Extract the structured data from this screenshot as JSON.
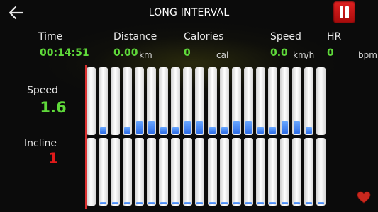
{
  "header": {
    "title": "LONG INTERVAL",
    "back_icon": "arrow-left-icon",
    "pause_icon": "pause-icon",
    "pause_color": "#d01818"
  },
  "stats": {
    "time": {
      "label": "Time",
      "value": "00:14:51",
      "unit": ""
    },
    "distance": {
      "label": "Distance",
      "value": "0.00",
      "unit": "km"
    },
    "calories": {
      "label": "Calories",
      "value": "0",
      "unit": "cal"
    },
    "speed": {
      "label": "Speed",
      "value": "0.0",
      "unit": "km/h"
    },
    "hr": {
      "label": "HR",
      "value": "0",
      "unit": "bpm"
    }
  },
  "program": {
    "speed_label": "Speed",
    "speed_value": "1.6",
    "incline_label": "Incline",
    "incline_value": "1",
    "speed_levels": [
      0,
      0.1,
      0,
      0.1,
      0.2,
      0.2,
      0.1,
      0.1,
      0.2,
      0.2,
      0.1,
      0.1,
      0.2,
      0.2,
      0.1,
      0.1,
      0.2,
      0.2,
      0.1,
      0
    ],
    "incline_levels": [
      0,
      0.02,
      0.02,
      0.02,
      0.02,
      0.02,
      0.02,
      0.02,
      0.02,
      0.02,
      0.02,
      0.02,
      0.02,
      0.02,
      0.02,
      0.02,
      0.02,
      0.02,
      0.02,
      0.02
    ],
    "colors": {
      "value_green": "#5fd93a",
      "incline_red": "#e01a1a",
      "bar_fill": "#3d7ef0"
    }
  },
  "footer": {
    "heart_icon": "heart-icon"
  }
}
